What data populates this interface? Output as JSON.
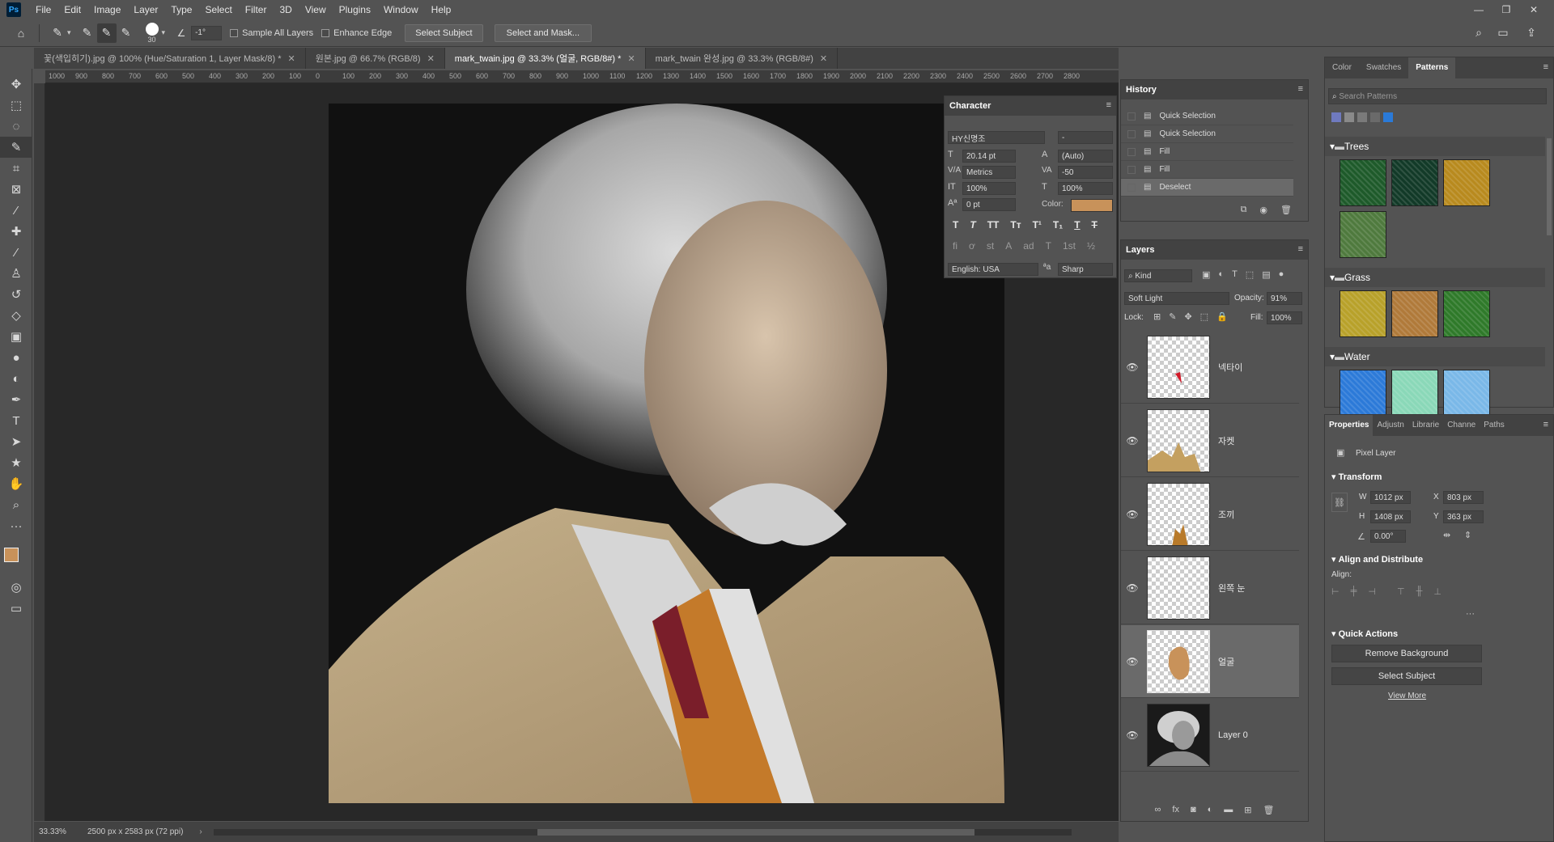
{
  "app": {
    "logo": "Ps"
  },
  "menu": [
    "File",
    "Edit",
    "Image",
    "Layer",
    "Type",
    "Select",
    "Filter",
    "3D",
    "View",
    "Plugins",
    "Window",
    "Help"
  ],
  "options": {
    "brush_size": "30",
    "angle": "-1°",
    "sample_all_layers": "Sample All Layers",
    "enhance_edge": "Enhance Edge",
    "select_subject": "Select Subject",
    "select_and_mask": "Select and Mask..."
  },
  "tabs": [
    {
      "label": "꽃(색입히기).jpg @ 100% (Hue/Saturation 1, Layer Mask/8) *",
      "active": false
    },
    {
      "label": "원본.jpg @ 66.7% (RGB/8)",
      "active": false
    },
    {
      "label": "mark_twain.jpg @ 33.3% (얼굴, RGB/8#) *",
      "active": true
    },
    {
      "label": "mark_twain 완성.jpg @ 33.3% (RGB/8#)",
      "active": false
    }
  ],
  "ruler_ticks": [
    "1000",
    "900",
    "800",
    "700",
    "600",
    "500",
    "400",
    "300",
    "200",
    "100",
    "0",
    "100",
    "200",
    "300",
    "400",
    "500",
    "600",
    "700",
    "800",
    "900",
    "1000",
    "1100",
    "1200",
    "1300",
    "1400",
    "1500",
    "1600",
    "1700",
    "1800",
    "1900",
    "2000",
    "2100",
    "2200",
    "2300",
    "2400",
    "2500",
    "2600",
    "2700",
    "2800"
  ],
  "status": {
    "zoom": "33.33%",
    "doc_size": "2500 px x 2583 px (72 ppi)"
  },
  "character": {
    "title": "Character",
    "font": "HY신명조",
    "style": "-",
    "size": "20.14 pt",
    "leading": "(Auto)",
    "kerning": "Metrics",
    "tracking": "-50",
    "vscale": "100%",
    "hscale": "100%",
    "baseline": "0 pt",
    "color_label": "Color:",
    "color": "#c8925a",
    "language": "English: USA",
    "antialias": "Sharp"
  },
  "history": {
    "title": "History",
    "items": [
      {
        "label": "Quick Selection",
        "icon": "quick-selection-icon"
      },
      {
        "label": "Quick Selection",
        "icon": "quick-selection-icon"
      },
      {
        "label": "Fill",
        "icon": "history-state-icon"
      },
      {
        "label": "Fill",
        "icon": "history-state-icon"
      },
      {
        "label": "Deselect",
        "icon": "history-state-icon"
      }
    ]
  },
  "layers": {
    "title": "Layers",
    "filter": "Kind",
    "blend_mode": "Soft Light",
    "opacity_label": "Opacity:",
    "opacity": "91%",
    "lock_label": "Lock:",
    "fill_label": "Fill:",
    "fill": "100%",
    "items": [
      {
        "name": "넥타이"
      },
      {
        "name": "자켓"
      },
      {
        "name": "조끼"
      },
      {
        "name": "왼쪽 눈"
      },
      {
        "name": "얼굴"
      },
      {
        "name": "Layer 0"
      }
    ]
  },
  "right_top": {
    "tabs": [
      "Color",
      "Swatches",
      "Patterns"
    ],
    "search_placeholder": "Search Patterns",
    "groups": [
      {
        "name": "Trees",
        "colors": [
          "#1e5a2a",
          "#123a28",
          "#b88a1e",
          "#4f7a3e"
        ]
      },
      {
        "name": "Grass",
        "colors": [
          "#b8a12a",
          "#b07a3a",
          "#2f7a2a"
        ]
      },
      {
        "name": "Water",
        "colors": [
          "#2c7ad8",
          "#8ad8b8",
          "#7ab8e8"
        ]
      }
    ]
  },
  "properties": {
    "tabs": [
      "Properties",
      "Adjustn",
      "Librarie",
      "Channe",
      "Paths"
    ],
    "kind": "Pixel Layer",
    "transform": "Transform",
    "w": "1012 px",
    "h": "1408 px",
    "x": "803 px",
    "y": "363 px",
    "angle": "0.00°",
    "align_distribute": "Align and Distribute",
    "align_label": "Align:",
    "quick_actions": "Quick Actions",
    "remove_bg": "Remove Background",
    "select_subject": "Select Subject",
    "view_more": "View More"
  }
}
